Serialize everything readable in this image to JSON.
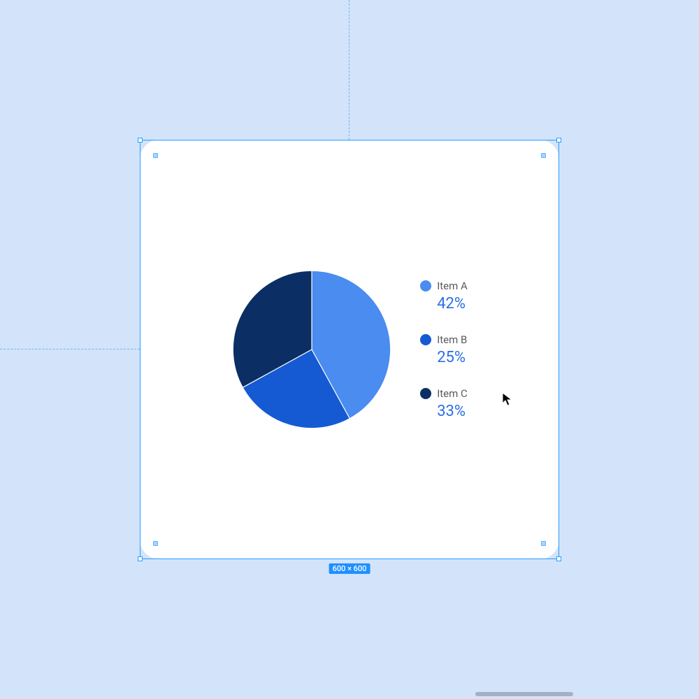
{
  "canvas": {
    "selection_size_label": "600 × 600"
  },
  "chart_data": {
    "type": "pie",
    "series": [
      {
        "name": "Item A",
        "value": 42,
        "display": "42%",
        "color": "#4a8cf0"
      },
      {
        "name": "Item B",
        "value": 25,
        "display": "25%",
        "color": "#155ad2"
      },
      {
        "name": "Item C",
        "value": 33,
        "display": "33%",
        "color": "#0b2f64"
      }
    ],
    "start_angle": 0,
    "direction": "clockwise",
    "title": "",
    "legend_position": "right",
    "value_label_color": "#2b6fe6"
  }
}
